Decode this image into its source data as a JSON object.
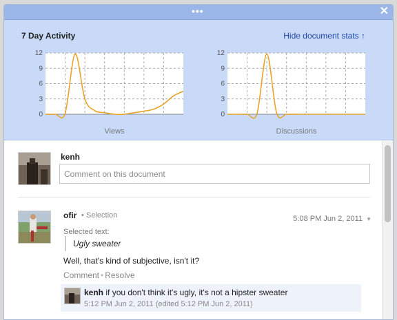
{
  "titlebar": {
    "drag_handle_glyph": "•••",
    "close_glyph": "✕"
  },
  "stats": {
    "title": "7 Day Activity",
    "hide_link": "Hide document stats ↑",
    "line_color": "#e8a32a"
  },
  "chart_data": [
    {
      "type": "line",
      "xlabel": "Views",
      "yticks": [
        "12",
        "9",
        "6",
        "3",
        "0"
      ],
      "ylim": [
        0,
        12
      ],
      "x": [
        0,
        0.5,
        1,
        1.5,
        2,
        2.5,
        3,
        3.5,
        4,
        4.5,
        5,
        5.5,
        6,
        6.5,
        7
      ],
      "values": [
        0,
        0,
        0.2,
        11.8,
        3,
        0.7,
        0.3,
        0,
        0,
        0.3,
        0.6,
        1,
        2,
        3.6,
        4.5
      ],
      "grid": true
    },
    {
      "type": "line",
      "xlabel": "Discussions",
      "yticks": [
        "12",
        "9",
        "6",
        "3",
        "0"
      ],
      "ylim": [
        0,
        12
      ],
      "x": [
        0,
        0.5,
        1,
        1.5,
        2,
        2.5,
        3,
        3.5,
        4,
        4.5,
        5,
        5.5,
        6,
        6.5,
        7
      ],
      "values": [
        0,
        0,
        0,
        0.1,
        11.8,
        0.2,
        0,
        0,
        0,
        0,
        0,
        0,
        0,
        0,
        0
      ],
      "grid": true
    }
  ],
  "new_comment": {
    "username": "kenh",
    "placeholder": "Comment on this document"
  },
  "thread": {
    "author": "ofir",
    "separator": "•",
    "type_label": "Selection",
    "timestamp": "5:08 PM Jun 2, 2011",
    "dropdown_glyph": "▼",
    "selected_label": "Selected text:",
    "quote": "Ugly sweater",
    "body": "Well, that's kind of subjective, isn't it?",
    "actions": {
      "comment": "Comment",
      "resolve": "Resolve"
    },
    "reply": {
      "author": "kenh",
      "text": "if you don't think it's ugly, it's not a hipster sweater",
      "meta": "5:12 PM Jun 2, 2011 (edited 5:12 PM Jun 2, 2011)"
    }
  }
}
